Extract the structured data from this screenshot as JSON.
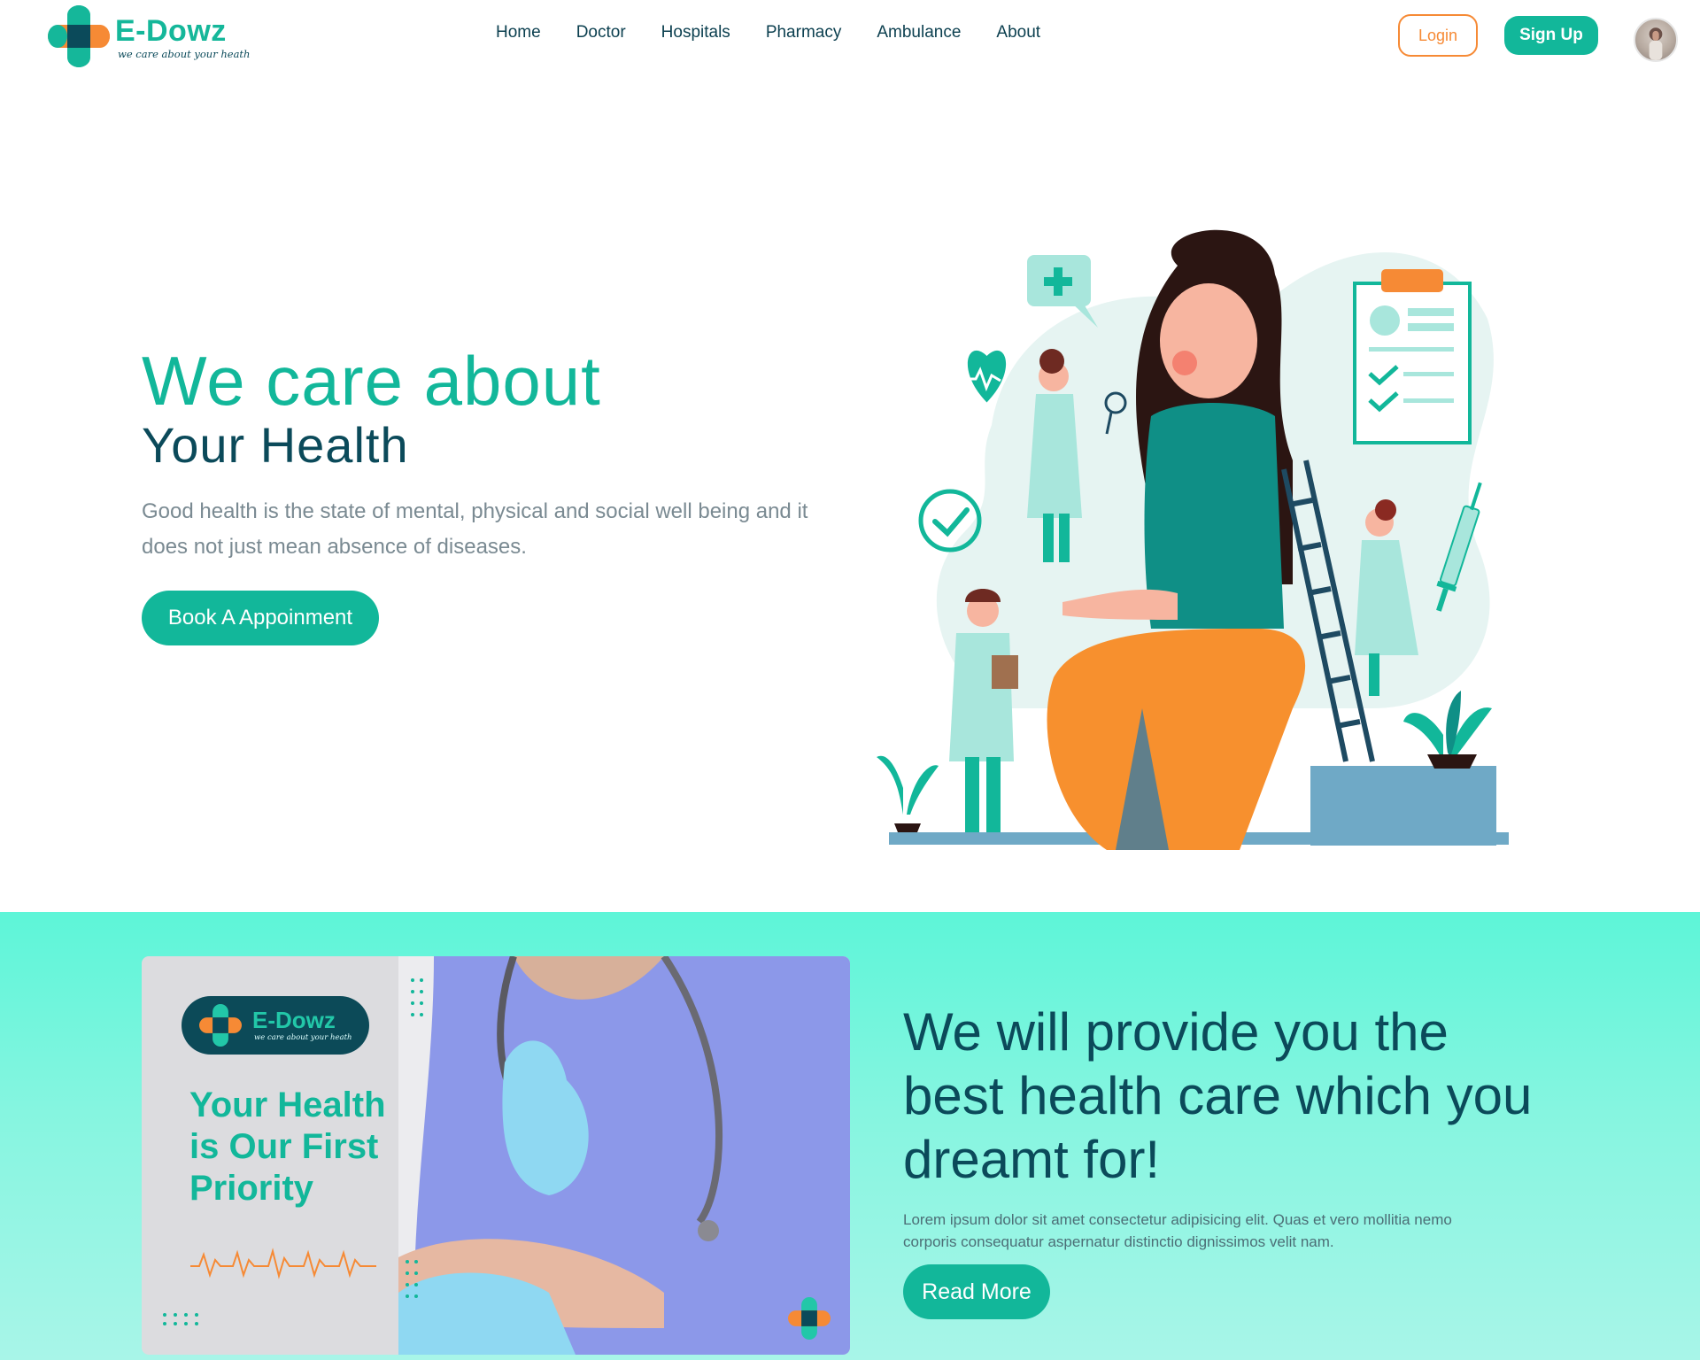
{
  "brand": {
    "name": "E-Dowz",
    "tagline": "we care about your heath"
  },
  "nav": {
    "links": [
      "Home",
      "Doctor",
      "Hospitals",
      "Pharmacy",
      "Ambulance",
      "About"
    ],
    "login_label": "Login",
    "signup_label": "Sign Up"
  },
  "hero": {
    "title_line1": "We care about",
    "title_line2": "Your Health",
    "description": "Good health is the state of mental, physical and social well being and it does not just mean absence of diseases.",
    "cta_label": "Book A Appoinment"
  },
  "section2": {
    "promo": {
      "badge_name": "E-Dowz",
      "badge_tagline": "we care about your heath",
      "heading": "Your Health is Our First Priority"
    },
    "title": "We will provide you the best health care which you dreamt for!",
    "description": "Lorem ipsum dolor sit amet consectetur adipisicing elit. Quas et vero mollitia nemo corporis consequatur aspernatur distinctio dignissimos velit nam.",
    "cta_label": "Read More"
  },
  "colors": {
    "primary": "#12b79a",
    "dark": "#0b4a5a",
    "accent": "#f68a35",
    "section_bg": "#5df5d8"
  },
  "icons": [
    "logo-cross-icon",
    "avatar",
    "heart-pulse-icon",
    "checkmark-icon",
    "plus-bubble-icon",
    "clipboard-icon",
    "syringe-icon",
    "plant-icon"
  ]
}
